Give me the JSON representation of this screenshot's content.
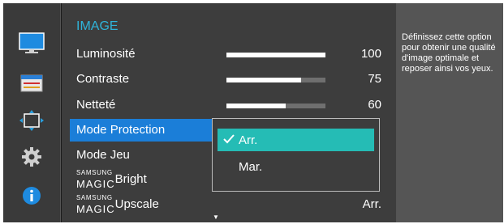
{
  "categories": [
    {
      "id": "picture",
      "icon": "monitor-icon"
    },
    {
      "id": "onscreen",
      "icon": "onscreen-display-icon"
    },
    {
      "id": "position",
      "icon": "screen-adjust-icon"
    },
    {
      "id": "system",
      "icon": "gear-icon"
    },
    {
      "id": "info",
      "icon": "info-icon"
    }
  ],
  "menu": {
    "title": "IMAGE",
    "items": [
      {
        "label": "Luminosité",
        "value": "100",
        "level": 100
      },
      {
        "label": "Contraste",
        "value": "75",
        "level": 75
      },
      {
        "label": "Netteté",
        "value": "60",
        "level": 60
      },
      {
        "label": "Mode Protection"
      },
      {
        "label": "Mode Jeu"
      },
      {
        "brand_small": "SAMSUNG",
        "brand_big": "MAGIC",
        "label": "Bright"
      },
      {
        "brand_small": "SAMSUNG",
        "brand_big": "MAGIC",
        "label": "Upscale",
        "value": "Arr."
      }
    ],
    "scroll_indicator": "▼"
  },
  "dropdown": {
    "options": [
      {
        "label": "Arr.",
        "selected": true
      },
      {
        "label": "Mar.",
        "selected": false
      }
    ]
  },
  "help": {
    "text": "Définissez cette option pour obtenir une qualité d'image optimale et reposer ainsi vos yeux."
  },
  "colors": {
    "accent_blue": "#1b7ed8",
    "selected_option": "#25bcb5",
    "title": "#2fb3d9"
  }
}
